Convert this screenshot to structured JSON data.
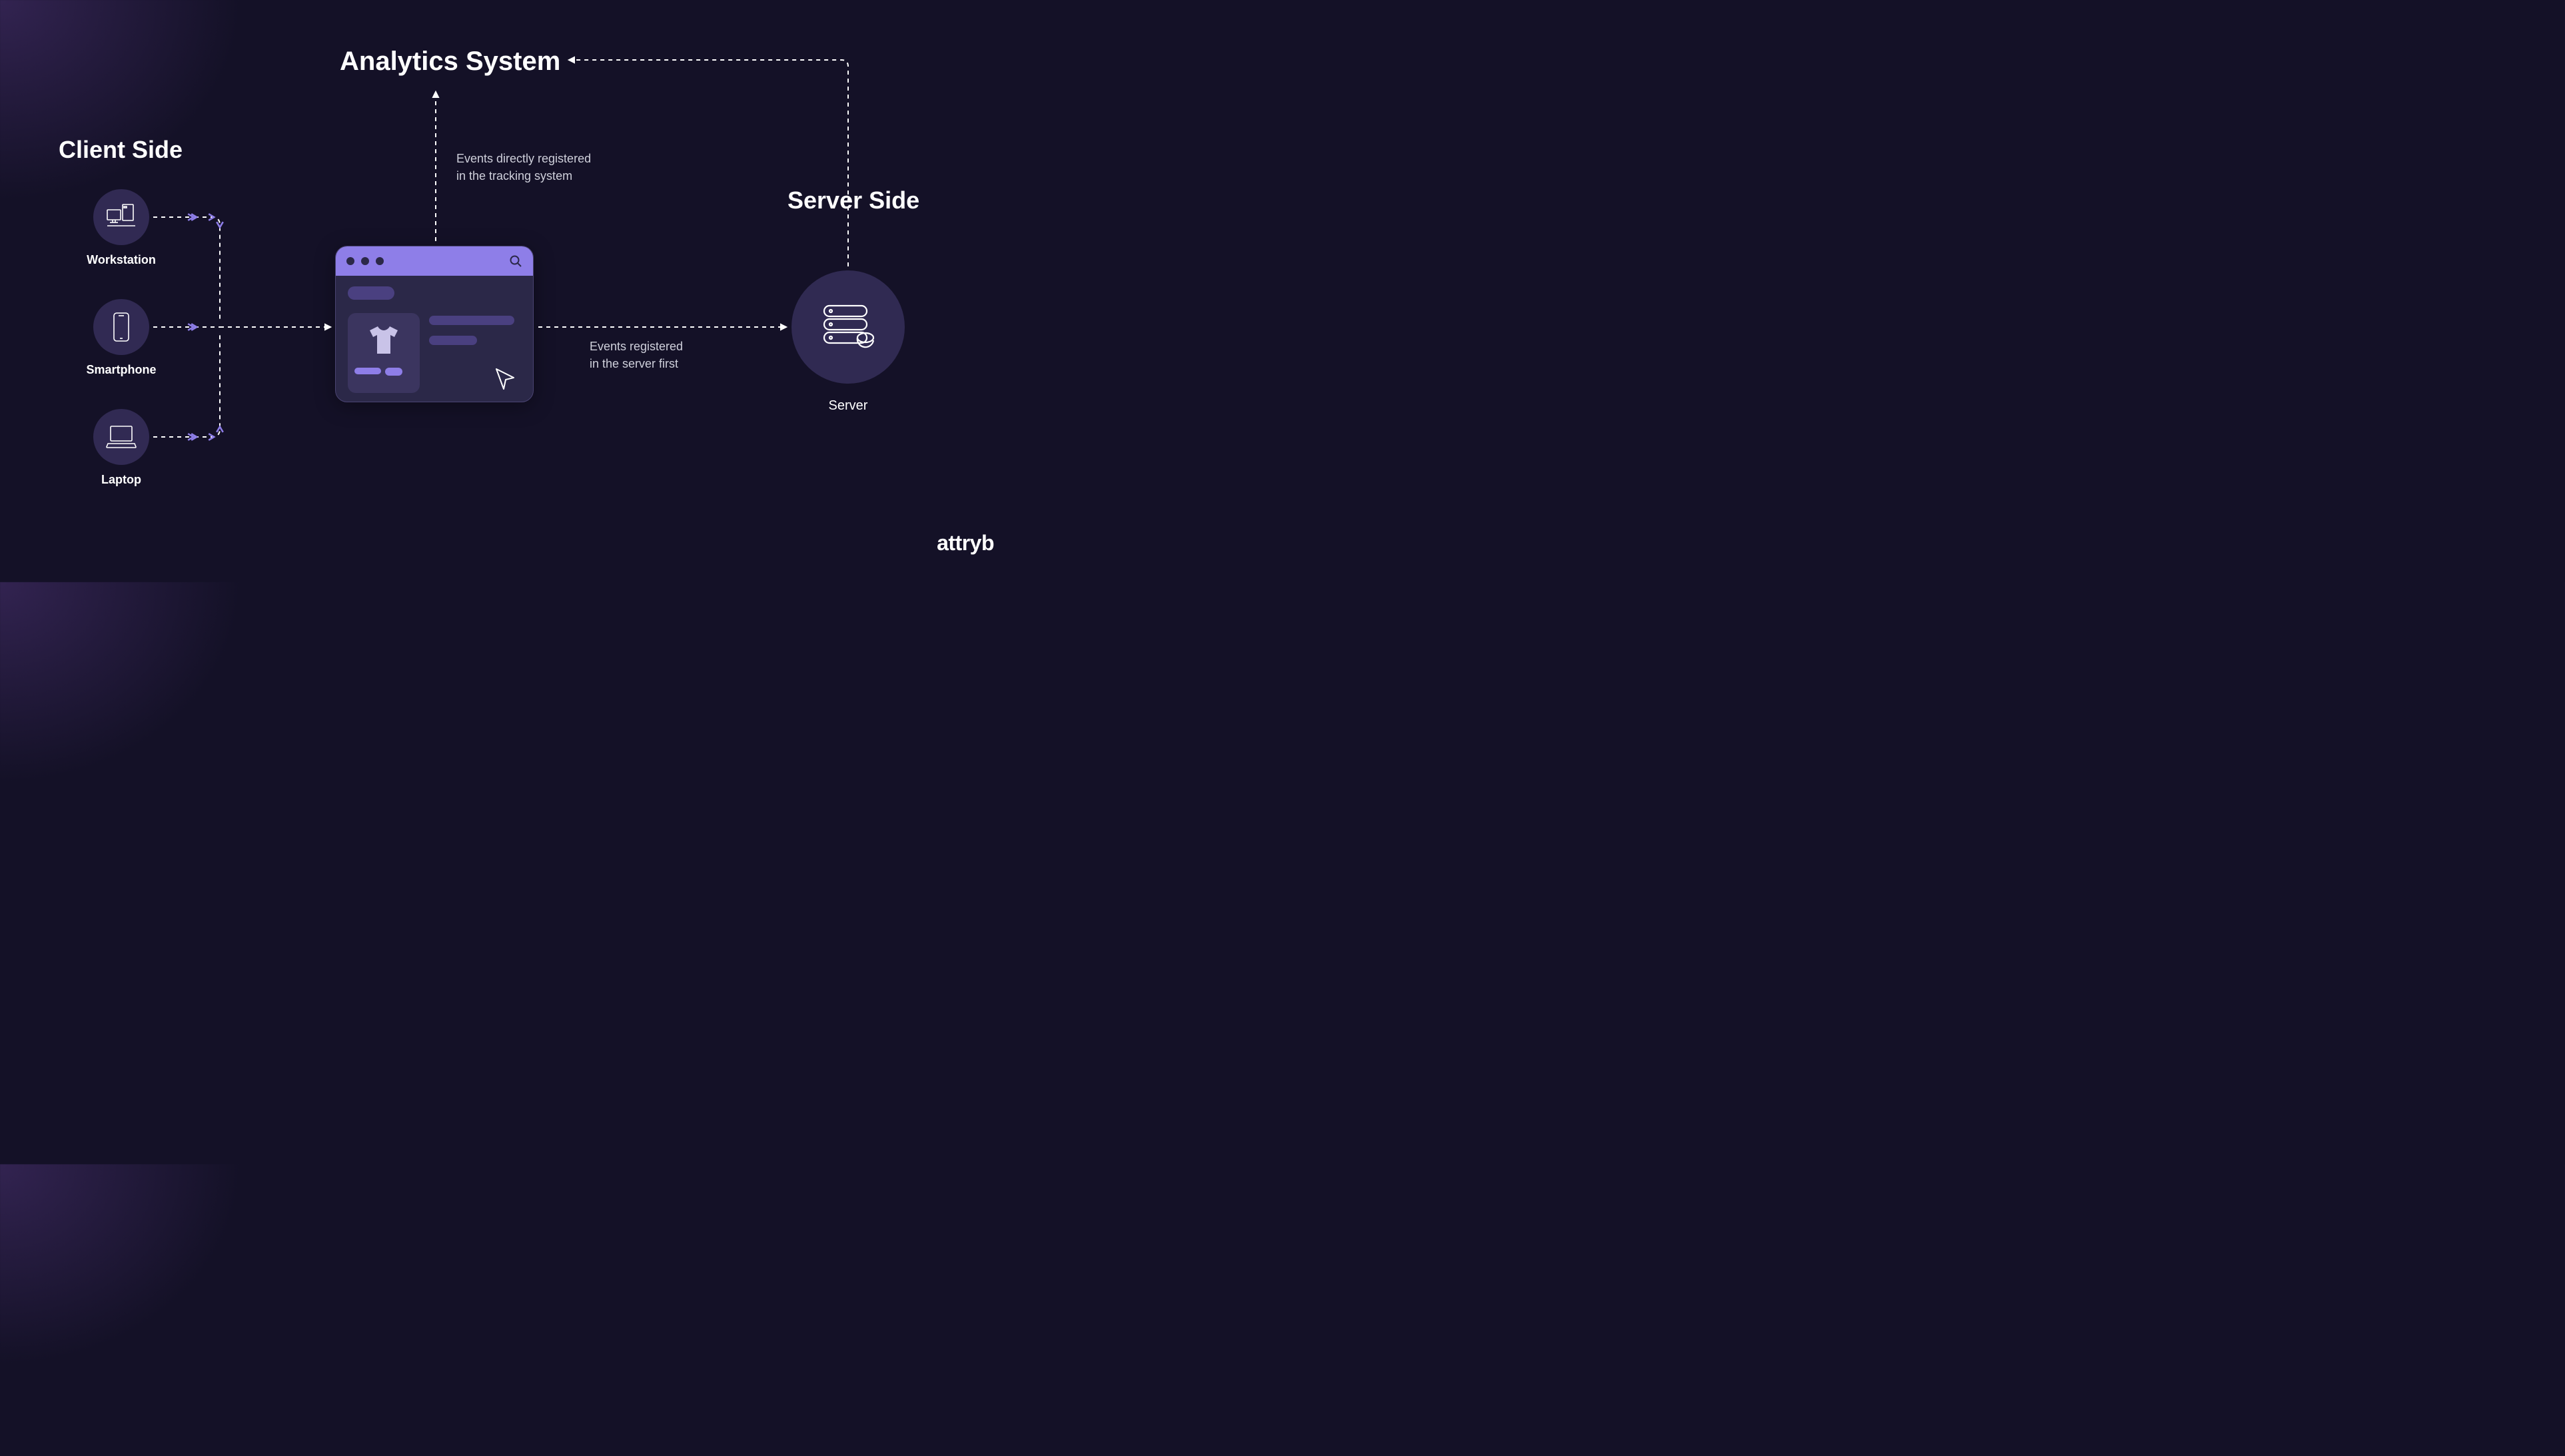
{
  "titles": {
    "analytics": "Analytics System",
    "client_side": "Client Side",
    "server_side": "Server Side"
  },
  "devices": {
    "workstation": "Workstation",
    "smartphone": "Smartphone",
    "laptop": "Laptop"
  },
  "server": {
    "label": "Server"
  },
  "captions": {
    "direct_line1": "Events directly registered",
    "direct_line2": "in the tracking system",
    "server_line1": "Events registered",
    "server_line2": "in the server first"
  },
  "brand": "attryb",
  "icons": {
    "workstation": "workstation-icon",
    "smartphone": "smartphone-icon",
    "laptop": "laptop-icon",
    "server": "server-icon",
    "search": "search-icon",
    "tshirt": "tshirt-icon",
    "cursor": "cursor-icon"
  },
  "colors": {
    "bg": "#141127",
    "accent": "#8e7ee8",
    "card": "#2b2848",
    "circle": "#312a53",
    "pill": "#4a4080"
  }
}
